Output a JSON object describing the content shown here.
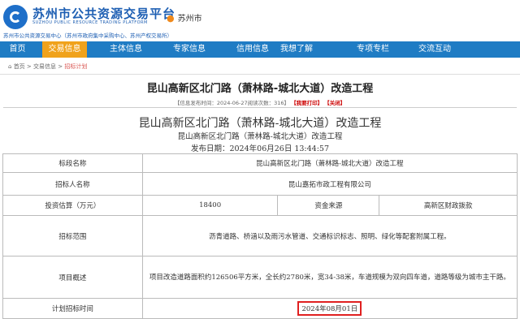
{
  "header": {
    "title": "苏州市公共资源交易平台",
    "subtitle": "SUZHOU PUBLIC RESOURCE TRADING PLATFORM",
    "description": "苏州市公共资源交易中心（苏州市政府集中采购中心、苏州产权交易所）",
    "location": "苏州市",
    "location_icon": "map-pin-icon"
  },
  "nav": {
    "items": [
      {
        "label": "首页"
      },
      {
        "label": "交易信息"
      },
      {
        "label": "主体信息"
      },
      {
        "label": "专家信息"
      },
      {
        "label": "信用信息"
      },
      {
        "label": "我想了解"
      },
      {
        "label": "专项专栏"
      },
      {
        "label": "交流互动"
      }
    ],
    "active": "交易信息",
    "active_color": "#f0a21b",
    "bar_color": "#1f7cc4"
  },
  "breadcrumb": {
    "home_icon": "home-icon",
    "items": [
      "首页",
      "交易信息",
      "招标计划"
    ]
  },
  "article": {
    "title": "昆山高新区北门路（萧林路-城北大道）改造工程",
    "meta_prefix": "【信息发布时间：2024-06-27阅读次数：316】",
    "print_label": "【我要打印】",
    "close_label": "【关闭】"
  },
  "document": {
    "title": "昆山高新区北门路（萧林路-城北大道）改造工程",
    "subtitle": "昆山高新区北门路（萧林路-城北大道）改造工程",
    "publish_date": "发布日期：2024年06月26日 13:44:57"
  },
  "table": {
    "section_name_label": "标段名称",
    "section_name": "昆山高新区北门路（萧林路-城北大道）改造工程",
    "tenderer_label": "招标人名称",
    "tenderer": "昆山嘉拓市政工程有限公司",
    "investment_label": "投资估算（万元）",
    "investment": "18400",
    "fund_source_label": "资金来源",
    "fund_source": "高新区财政拨款",
    "scope_label": "招标范围",
    "scope": "沥青道路、桥涵以及雨污水管道、交通标识标志、照明、绿化等配套附属工程。",
    "overview_label": "项目概述",
    "overview": "项目改造道路面积约126506平方米，全长约2780米，宽34-38米，车道规模为双向四车道，道路等级为城市主干路。",
    "plan_time_label": "计划招标时间",
    "plan_time": "2024年08月01日",
    "highlight_color": "#e02020"
  }
}
